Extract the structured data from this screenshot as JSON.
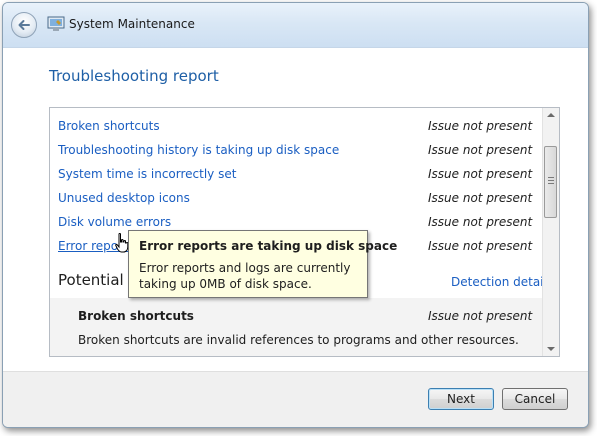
{
  "window": {
    "title": "System Maintenance"
  },
  "heading": "Troubleshooting report",
  "issues": [
    {
      "label": "Broken shortcuts",
      "status": "Issue not present"
    },
    {
      "label": "Troubleshooting history is taking up disk space",
      "status": "Issue not present"
    },
    {
      "label": "System time is incorrectly set",
      "status": "Issue not present"
    },
    {
      "label": "Unused desktop icons",
      "status": "Issue not present"
    },
    {
      "label": "Disk volume errors",
      "status": "Issue not present"
    },
    {
      "label": "Error reports",
      "status": "Issue not present"
    }
  ],
  "potential_section": {
    "title": "Potential is",
    "details_link": "Detection details"
  },
  "detail": {
    "name": "Broken shortcuts",
    "status": "Issue not present",
    "description": "Broken shortcuts are invalid references to programs and other resources."
  },
  "tooltip": {
    "title": "Error reports are taking up disk space",
    "body": "Error reports and logs are currently taking up 0MB of disk space."
  },
  "buttons": {
    "next": "Next",
    "cancel": "Cancel"
  },
  "colors": {
    "link": "#1a5ec2",
    "heading": "#1e5fa6",
    "tooltip_bg": "#ffffe1"
  }
}
